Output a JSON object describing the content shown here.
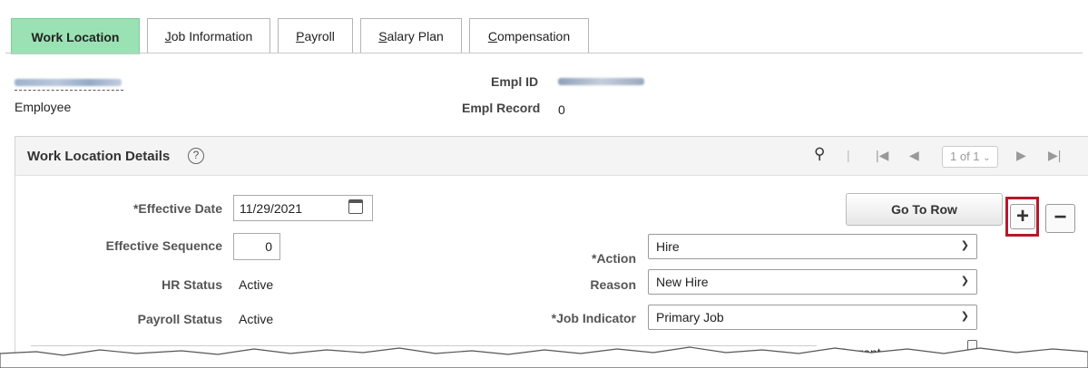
{
  "tabs": [
    {
      "label": "Work Location",
      "active": true
    },
    {
      "label": "Job Information",
      "active": false,
      "accesskey": "J"
    },
    {
      "label": "Payroll",
      "active": false,
      "accesskey": "P"
    },
    {
      "label": "Salary Plan",
      "active": false,
      "accesskey": "S"
    },
    {
      "label": "Compensation",
      "active": false,
      "accesskey": "C"
    }
  ],
  "header": {
    "employee_type": "Employee",
    "empl_id_label": "Empl ID",
    "empl_record_label": "Empl Record",
    "empl_record_value": "0"
  },
  "panel": {
    "title": "Work Location Details",
    "pagination": "1 of 1"
  },
  "form": {
    "effective_date_label": "*Effective Date",
    "effective_date_value": "11/29/2021",
    "effective_sequence_label": "Effective Sequence",
    "effective_sequence_value": "0",
    "hr_status_label": "HR Status",
    "hr_status_value": "Active",
    "payroll_status_label": "Payroll Status",
    "payroll_status_value": "Active",
    "action_label": "*Action",
    "action_value": "Hire",
    "reason_label": "Reason",
    "reason_value": "New Hire",
    "job_indicator_label": "*Job Indicator",
    "job_indicator_value": "Primary Job",
    "current_label": "Current"
  },
  "buttons": {
    "go_to_row": "Go To Row",
    "add_row": "+",
    "delete_row": "−"
  },
  "colors": {
    "active_tab": "#9ae2b3",
    "highlight_border": "#b4192a"
  }
}
